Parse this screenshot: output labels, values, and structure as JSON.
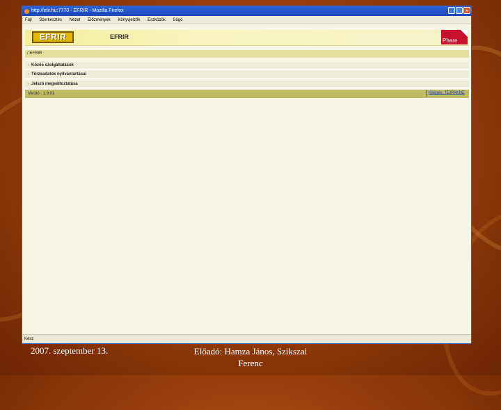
{
  "slide": {
    "footer_date": "2007. szeptember 13.",
    "footer_presenter": "Előadó: Hamza János, Szikszai Ferenc"
  },
  "browser": {
    "title": "http://efir.hu:7770 - EFRIR - Mozilla Firefox",
    "menu": [
      "Fájl",
      "Szerkesztés",
      "Nézet",
      "Előzmények",
      "Könyvjelzők",
      "Eszközök",
      "Súgó"
    ],
    "status_text": "Kész"
  },
  "app": {
    "logo_text": "EFRIR",
    "banner_title": "EFRIR",
    "partner_logo_text": "Phare",
    "breadcrumb": "/ EFRIR",
    "menu_items": [
      "Közös szolgáltatások",
      "Törzsadatok nyilvántartásai",
      "Jelszó megváltoztatása"
    ],
    "version_text": "Verzió : 1.9.01",
    "logout_label": "Kilépés: TEIPAKNE"
  },
  "colors": {
    "background": "#9a3f0c",
    "titlebar": "#1b47b8",
    "banner": "#f2ef9a",
    "statusline": "#bfbc66",
    "phare_red": "#c8102e"
  }
}
